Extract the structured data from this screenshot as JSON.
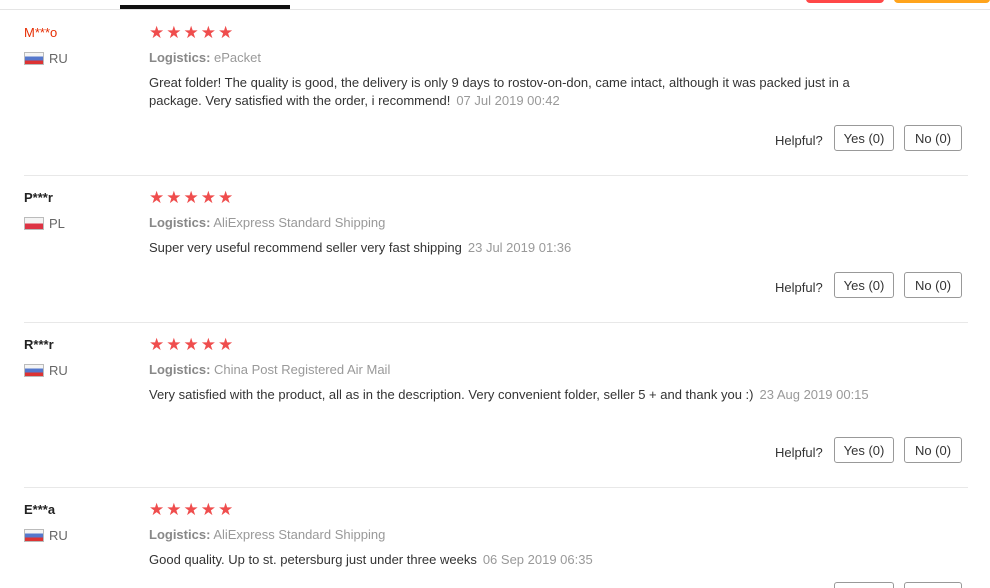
{
  "helpful_label": "Helpful?",
  "colors": {
    "star": "#ef4d4d",
    "accent_red": "#ff4747",
    "accent_orange": "#ffa41c"
  },
  "reviews": [
    {
      "user": "M***o",
      "country": "RU",
      "rating": 5,
      "logistics_label": "Logistics:",
      "logistics": "ePacket",
      "text": "Great folder! The quality is good, the delivery is only 9 days to rostov-on-don, came intact, although it was packed just in a package. Very satisfied with the order, i recommend!",
      "date": "07 Jul 2019 00:42",
      "yes": "Yes (0)",
      "no": "No (0)"
    },
    {
      "user": "P***r",
      "country": "PL",
      "rating": 5,
      "logistics_label": "Logistics:",
      "logistics": "AliExpress Standard Shipping",
      "text": "Super very useful recommend seller very fast shipping",
      "date": "23 Jul 2019 01:36",
      "yes": "Yes (0)",
      "no": "No (0)"
    },
    {
      "user": "R***r",
      "country": "RU",
      "rating": 5,
      "logistics_label": "Logistics:",
      "logistics": "China Post Registered Air Mail",
      "text": "Very satisfied with the product, all as in the description. Very convenient folder, seller 5 + and thank you :)",
      "date": "23 Aug 2019 00:15",
      "yes": "Yes (0)",
      "no": "No (0)"
    },
    {
      "user": "E***a",
      "country": "RU",
      "rating": 5,
      "logistics_label": "Logistics:",
      "logistics": "AliExpress Standard Shipping",
      "text": "Good quality. Up to st. petersburg just under three weeks",
      "date": "06 Sep 2019 06:35"
    }
  ]
}
